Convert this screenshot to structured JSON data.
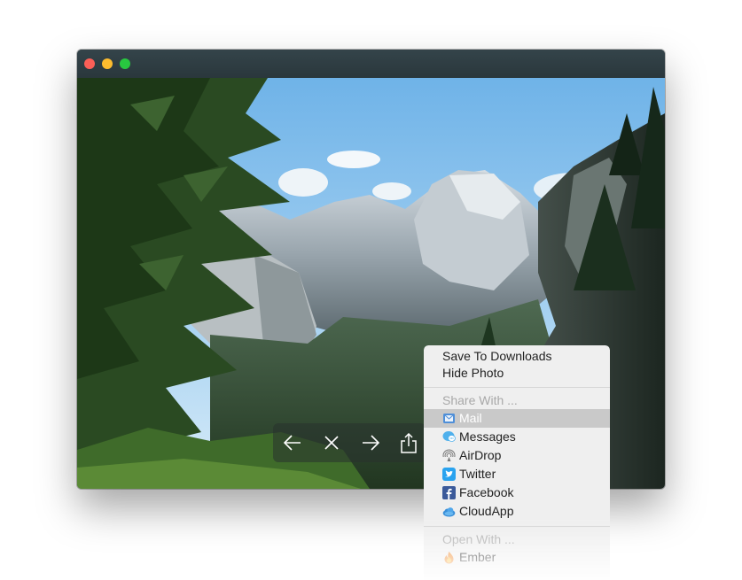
{
  "window": {
    "controls": [
      "close",
      "minimize",
      "zoom"
    ]
  },
  "toolbar": {
    "buttons": [
      {
        "icon": "arrow-left-icon"
      },
      {
        "icon": "close-icon"
      },
      {
        "icon": "arrow-right-icon"
      },
      {
        "icon": "share-icon"
      }
    ]
  },
  "menu": {
    "actions": [
      "Save To Downloads",
      "Hide Photo"
    ],
    "share_header": "Share With ...",
    "share_items": [
      {
        "label": "Mail",
        "icon": "mail-icon",
        "selected": true
      },
      {
        "label": "Messages",
        "icon": "messages-icon"
      },
      {
        "label": "AirDrop",
        "icon": "airdrop-icon"
      },
      {
        "label": "Twitter",
        "icon": "twitter-icon"
      },
      {
        "label": "Facebook",
        "icon": "facebook-icon"
      },
      {
        "label": "CloudApp",
        "icon": "cloudapp-icon"
      }
    ],
    "open_header": "Open With ...",
    "open_items": [
      {
        "label": "Ember",
        "icon": "ember-icon"
      }
    ]
  },
  "colors": {
    "titlebar": "#2c3a40",
    "close": "#fc5f57",
    "minimize": "#fdbc2e",
    "zoom": "#28c840",
    "selection": "#c9c9c9"
  }
}
